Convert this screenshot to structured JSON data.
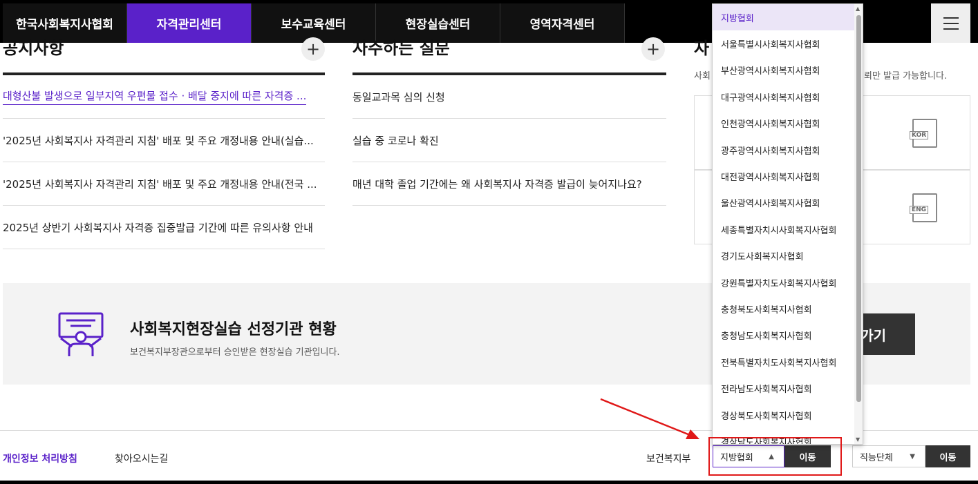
{
  "nav": {
    "items": [
      {
        "label": "한국사회복지사협회",
        "active": false
      },
      {
        "label": "자격관리센터",
        "active": true
      },
      {
        "label": "보수교육센터",
        "active": false
      },
      {
        "label": "현장실습센터",
        "active": false
      },
      {
        "label": "영역자격센터",
        "active": false
      }
    ]
  },
  "notice": {
    "title": "공지사항",
    "items": [
      "대형산불 발생으로 일부지역 우편물 접수 · 배달 중지에 따른 자격증 ...",
      "'2025년 사회복지사 자격관리 지침' 배포 및 주요 개정내용 안내(실습...",
      "'2025년 사회복지사 자격관리 지침' 배포 및 주요 개정내용 안내(전국 ...",
      "2025년 상반기 사회복지사 자격증 집중발급 기간에 따른 유의사항 안내"
    ]
  },
  "faq": {
    "title": "자주하는 질문",
    "items": [
      "동일교과목 심의 신청",
      "실습 중 코로나 확진",
      "매년 대학 졸업 기간에는 왜 사회복지사 자격증 발급이 늦어지나요?"
    ]
  },
  "cert": {
    "title_fragment": "자",
    "desc_fragment": "사회",
    "desc_tail": "뢰만 발급 가능합니다.",
    "kor_tag": "KOR",
    "eng_tag": "ENG"
  },
  "banner": {
    "title": "사회복지현장실습 선정기관 현황",
    "subtitle": "보건복지부장관으로부터 승인받은 현장실습 기관입니다.",
    "button_fragment": "가기"
  },
  "footer": {
    "privacy": "개인정보 처리방침",
    "directions": "찾아오시는길",
    "mohw": "보건복지부",
    "local_select": "지방협회",
    "go_label": "이동",
    "job_select": "직능단체",
    "go_label_2": "이동"
  },
  "dropdown": {
    "options": [
      "지방협회",
      "서울특별시사회복지사협회",
      "부산광역시사회복지사협회",
      "대구광역시사회복지사협회",
      "인천광역시사회복지사협회",
      "광주광역시사회복지사협회",
      "대전광역시사회복지사협회",
      "울산광역시사회복지사협회",
      "세종특별자치시사회복지사협회",
      "경기도사회복지사협회",
      "강원특별자치도사회복지사협회",
      "충청북도사회복지사협회",
      "충청남도사회복지사협회",
      "전북특별자치도사회복지사협회",
      "전라남도사회복지사협회",
      "경상북도사회복지사협회",
      "경상남도사회복지사협회"
    ]
  },
  "colors": {
    "accent": "#5a21c9",
    "annotation": "#e01818"
  }
}
